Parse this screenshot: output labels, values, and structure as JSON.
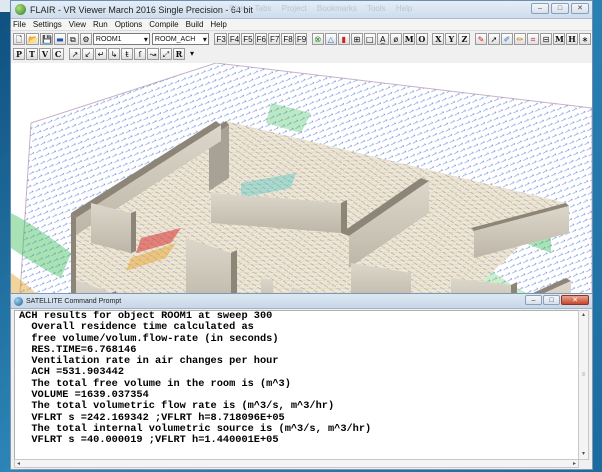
{
  "main_window": {
    "title": "FLAIR - VR Viewer March 2016 Single Precision - 64 bit",
    "ghost_menu": "Size  Tabs  Project  Bookmarks  Tools  Help",
    "window_buttons": [
      "–",
      "□",
      "✕"
    ],
    "menu": [
      "File",
      "Settings",
      "View",
      "Run",
      "Options",
      "Compile",
      "Build",
      "Help"
    ],
    "object_combo": "ROOM1",
    "variable_combo": "ROOM_ACH",
    "fkeys": [
      "F3",
      "F4",
      "F5",
      "F6",
      "F7",
      "F8",
      "F9"
    ],
    "view_letters": [
      "M",
      "O",
      "X",
      "Y",
      "Z"
    ],
    "right_letters": [
      "M",
      "H"
    ],
    "row2_letters": [
      "P",
      "T",
      "V",
      "C",
      "R"
    ],
    "accent_colors": {
      "title_bg": "#d6e3f1",
      "desktop": "#1f6b9f",
      "close_red": "#c7472b"
    }
  },
  "cmd_window": {
    "title": "SATELLITE Command Prompt",
    "window_buttons": [
      "–",
      "□",
      "✕"
    ],
    "lines": [
      "ACH results for object ROOM1 at sweep 300",
      "  Overall residence time calculated as",
      "  free volume/volum.flow-rate (in seconds)",
      "  RES.TIME=6.768146",
      "  Ventilation rate in air changes per hour",
      "  ACH =531.903442",
      "  The total free volume in the room is (m^3)",
      "  VOLUME =1639.037354",
      "  The total volumetric flow rate is (m^3/s, m^3/hr)",
      "  VFLRT s =242.169342 ;VFLRT h=8.718096E+05",
      "  The total internal volumetric source is (m^3/s, m^3/hr)",
      "  VFLRT s =40.000019 ;VFLRT h=1.440001E+05"
    ]
  }
}
